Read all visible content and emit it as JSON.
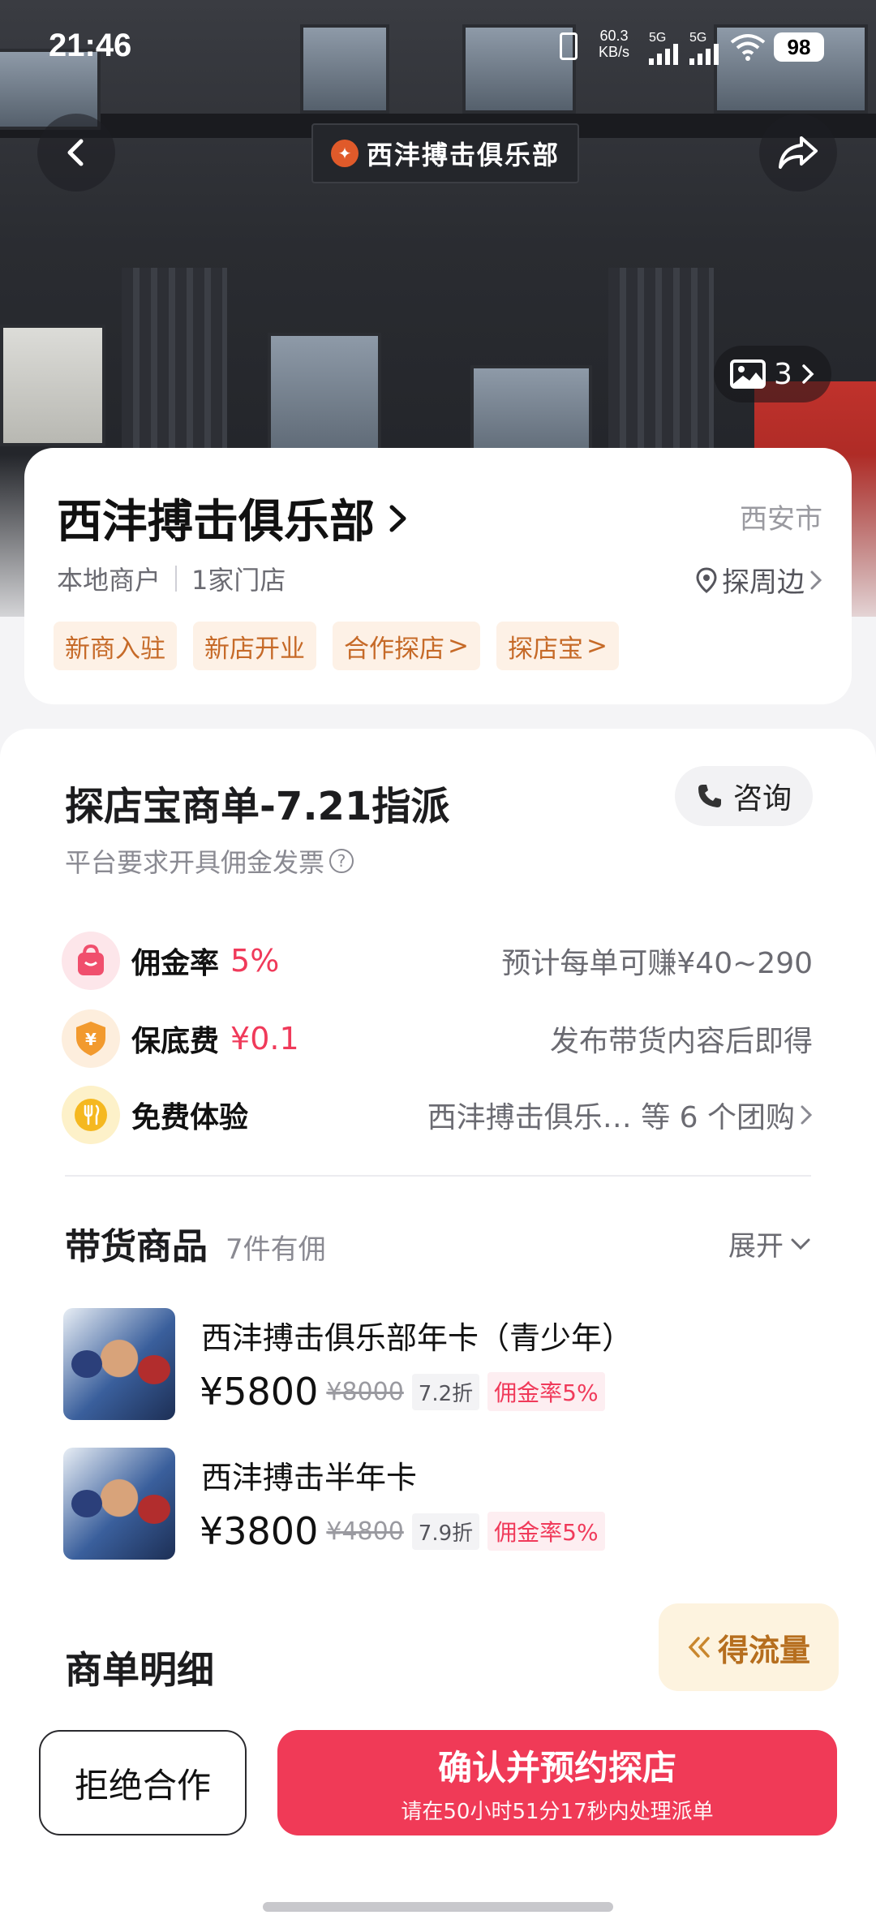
{
  "status_bar": {
    "time": "21:46",
    "net_speed_value": "60.3",
    "net_speed_unit": "KB/s",
    "signal_1": "5G",
    "signal_2": "5G",
    "battery": "98"
  },
  "hero": {
    "sign_text": "西沣搏击俱乐部",
    "photo_count": "3"
  },
  "merchant": {
    "name": "西沣搏击俱乐部",
    "city": "西安市",
    "type": "本地商户",
    "stores": "1家门店",
    "explore_label": "探周边",
    "tags": [
      {
        "label": "新商入驻",
        "arrow": ""
      },
      {
        "label": "新店开业",
        "arrow": ""
      },
      {
        "label": "合作探店",
        "arrow": ">"
      },
      {
        "label": "探店宝",
        "arrow": ">"
      }
    ]
  },
  "order": {
    "title": "探店宝商单-7.21指派",
    "consult_label": "咨询",
    "invoice_note": "平台要求开具佣金发票",
    "rows": [
      {
        "label": "佣金率",
        "value": "5%",
        "right": "预计每单可赚¥40~290"
      },
      {
        "label": "保底费",
        "value": "¥0.1",
        "right": "发布带货内容后即得"
      },
      {
        "label": "免费体验",
        "value": "",
        "right": "西沣搏击俱乐… 等 6 个团购"
      }
    ]
  },
  "goods": {
    "heading": "带货商品",
    "count_note": "7件有佣",
    "expand_label": "展开",
    "items": [
      {
        "name": "西沣搏击俱乐部年卡（青少年）",
        "price": "¥5800",
        "original": "¥8000",
        "discount": "7.2折",
        "rate": "佣金率5%"
      },
      {
        "name": "西沣搏击半年卡",
        "price": "¥3800",
        "original": "¥4800",
        "discount": "7.9折",
        "rate": "佣金率5%"
      }
    ]
  },
  "details": {
    "heading": "商单明细",
    "traffic_label": "得流量"
  },
  "actions": {
    "reject_label": "拒绝合作",
    "confirm_label": "确认并预约探店",
    "confirm_sub": "请在50小时51分17秒内处理派单"
  },
  "colors": {
    "accent_red": "#f03a57",
    "tag_orange": "#c66a28",
    "highlight_pink": "#f03a5a"
  }
}
